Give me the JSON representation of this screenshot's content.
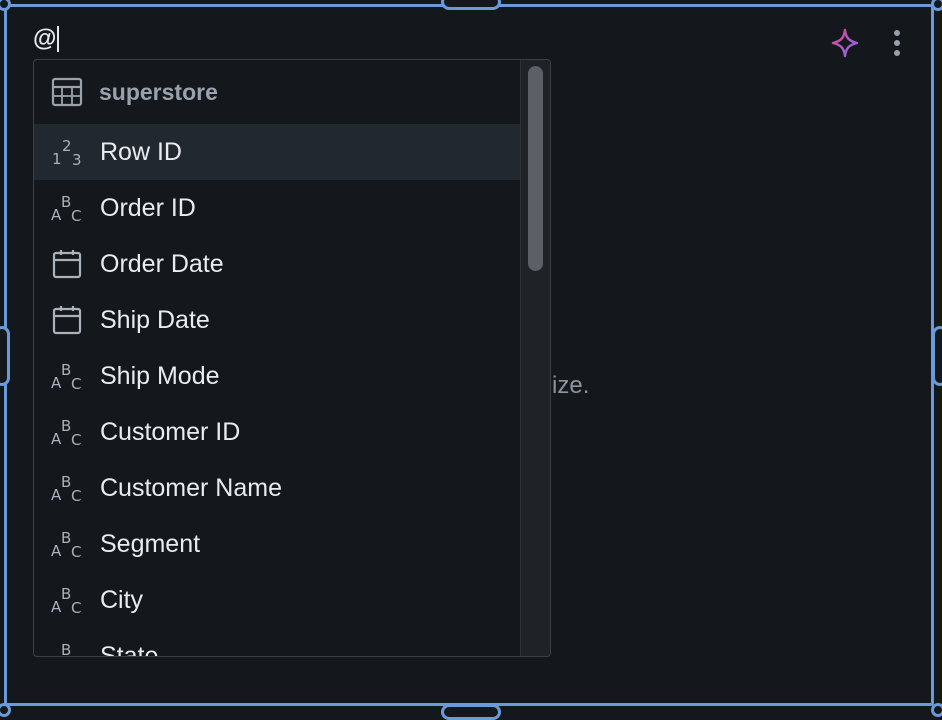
{
  "input": {
    "value": "@"
  },
  "background_text": "ualize.",
  "dropdown": {
    "group": {
      "label": "superstore",
      "icon": "table-icon"
    },
    "items": [
      {
        "label": "Row ID",
        "icon": "numeric-123-icon",
        "active": true
      },
      {
        "label": "Order ID",
        "icon": "text-abc-icon"
      },
      {
        "label": "Order Date",
        "icon": "calendar-icon"
      },
      {
        "label": "Ship Date",
        "icon": "calendar-icon"
      },
      {
        "label": "Ship Mode",
        "icon": "text-abc-icon"
      },
      {
        "label": "Customer ID",
        "icon": "text-abc-icon"
      },
      {
        "label": "Customer Name",
        "icon": "text-abc-icon"
      },
      {
        "label": "Segment",
        "icon": "text-abc-icon"
      },
      {
        "label": "City",
        "icon": "text-abc-icon"
      },
      {
        "label": "State",
        "icon": "text-abc-icon"
      }
    ]
  },
  "actions": {
    "ai_icon": "sparkle-icon",
    "more_icon": "more-vertical-icon"
  },
  "colors": {
    "frame": "#6a9bd8",
    "background": "#14181d",
    "active_row": "#222830",
    "sparkle_start": "#e0488b",
    "sparkle_end": "#7a6cf0"
  }
}
